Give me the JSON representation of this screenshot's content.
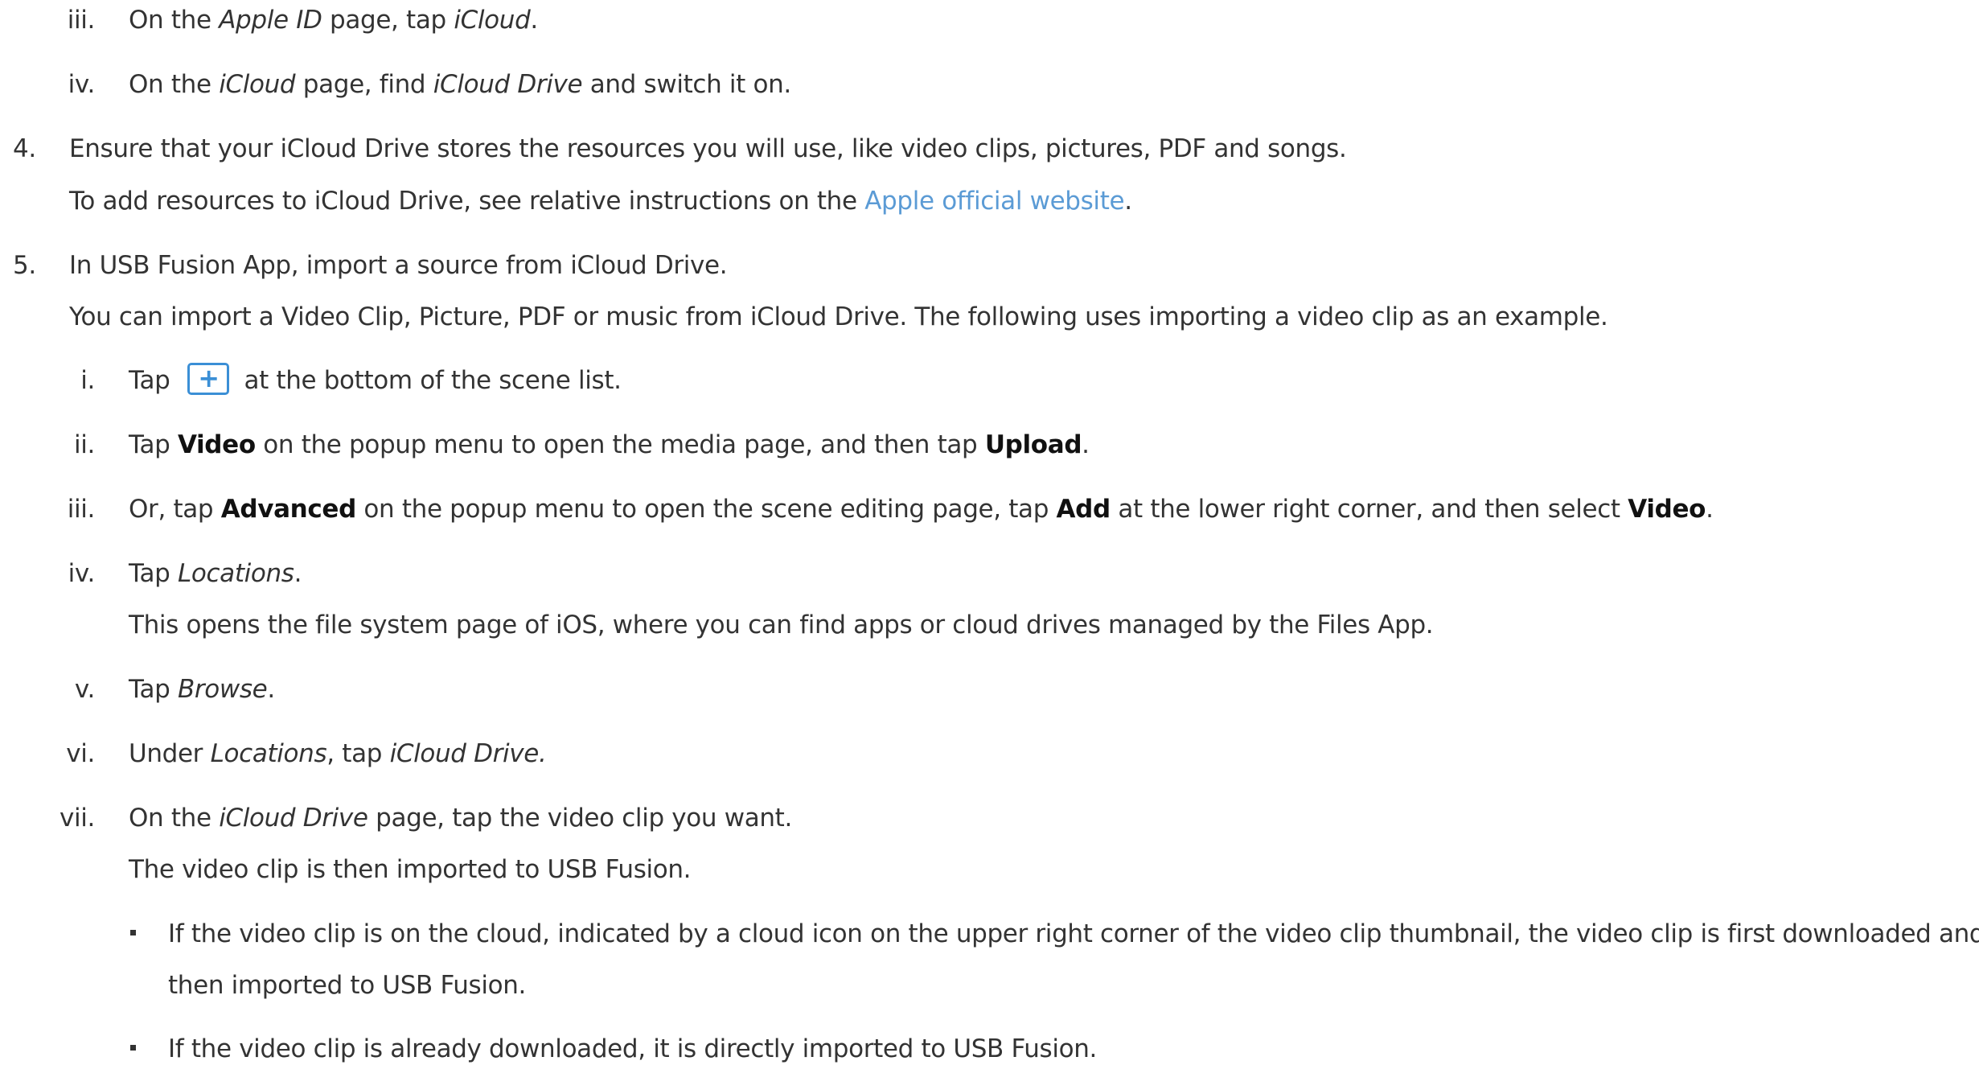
{
  "items": {
    "s3_iii": {
      "num": "iii.",
      "a": "On the ",
      "b": "Apple ID",
      "c": " page, tap ",
      "d": "iCloud",
      "e": "."
    },
    "s3_iv": {
      "num": "iv.",
      "a": "On the ",
      "b": "iCloud",
      "c": " page, find ",
      "d": "iCloud Drive",
      "e": " and switch it on."
    },
    "s4": {
      "num": "4.",
      "text": "Ensure that your iCloud Drive stores the resources you will use, like video clips, pictures, PDF and songs.",
      "sub_a": "To add resources to iCloud Drive, see relative instructions on the ",
      "sub_link": "Apple official website",
      "sub_b": "."
    },
    "s5": {
      "num": "5.",
      "text": "In USB Fusion App, import a source from iCloud Drive.",
      "sub": "You can import a Video Clip, Picture, PDF or music from iCloud Drive. The following uses importing a video clip as an example."
    },
    "s5_i": {
      "num": "i.",
      "a": "Tap",
      "icon": "+",
      "b": "at the bottom of the scene list."
    },
    "s5_ii": {
      "num": "ii.",
      "a": "Tap ",
      "b": "Video",
      "c": " on the popup menu to open the media page, and then tap ",
      "d": "Upload",
      "e": "."
    },
    "s5_iii": {
      "num": "iii.",
      "a": "Or, tap ",
      "b": "Advanced",
      "c": " on the popup menu to open the scene editing page, tap ",
      "d": "Add",
      "e": " at the lower right corner, and then select ",
      "f": "Video",
      "g": "."
    },
    "s5_iv": {
      "num": "iv.",
      "a": "Tap ",
      "b": "Locations",
      "c": ".",
      "sub": "This opens the file system page of iOS, where you can find apps or cloud drives managed by the Files App."
    },
    "s5_v": {
      "num": "v.",
      "a": "Tap ",
      "b": "Browse",
      "c": "."
    },
    "s5_vi": {
      "num": "vi.",
      "a": "Under ",
      "b": "Locations",
      "c": ", tap ",
      "d": "iCloud Drive."
    },
    "s5_vii": {
      "num": "vii.",
      "a": "On the ",
      "b": "iCloud Drive",
      "c": " page, tap the video clip you want.",
      "sub": "The video clip is then imported to USB Fusion."
    },
    "bullet1": {
      "line1": "If the video clip is on the cloud, indicated by a cloud icon on the upper right corner of the video clip thumbnail, the video clip is first downloaded and",
      "line2": "then imported to USB Fusion."
    },
    "bullet2": {
      "line1": "If the video clip is already downloaded, it is directly imported to USB Fusion."
    }
  },
  "colors": {
    "text": "#333333",
    "link": "#5b9bd5",
    "icon": "#3b8fd6"
  }
}
